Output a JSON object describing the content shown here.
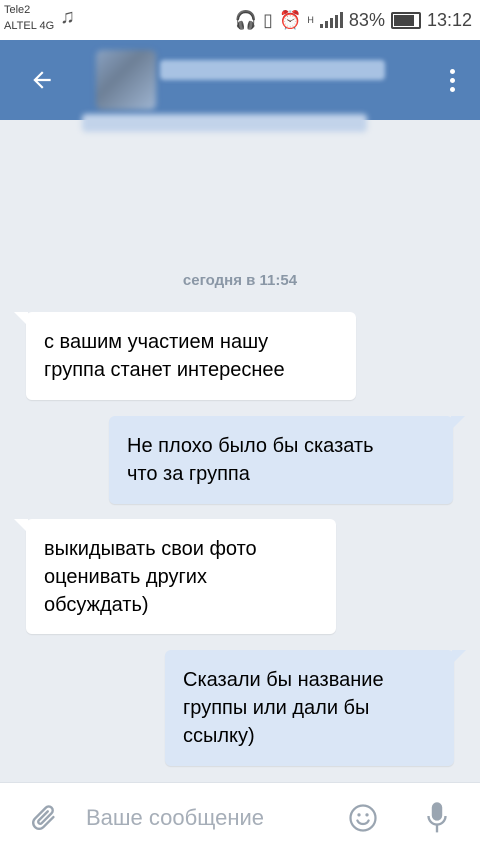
{
  "status_bar": {
    "carrier1": "Tele2",
    "carrier2": "ALTEL 4G",
    "network": "H",
    "battery": "83%",
    "time": "13:12"
  },
  "header": {
    "back_icon": "arrow-left-icon",
    "menu_icon": "more-vertical-icon"
  },
  "chat": {
    "date_separator": "сегодня в 11:54",
    "messages": [
      {
        "direction": "in",
        "lines": [
          "с вашим участием нашу",
          "группа станет интереснее"
        ]
      },
      {
        "direction": "out",
        "lines": [
          "Не плохо было бы сказать",
          "что за группа"
        ]
      },
      {
        "direction": "in",
        "lines": [
          "выкидывать свои фото",
          "оценивать других",
          "обсуждать)"
        ]
      },
      {
        "direction": "out",
        "lines": [
          "Сказали бы название",
          "группы или дали бы",
          "ссылку)"
        ]
      }
    ]
  },
  "composer": {
    "placeholder": "Ваше сообщение",
    "attach_icon": "paperclip-icon",
    "emoji_icon": "smile-icon",
    "mic_icon": "microphone-icon"
  },
  "colors": {
    "header_bg": "#5481b8",
    "chat_bg": "#e9edf2",
    "outgoing_bubble": "#dae6f6",
    "incoming_bubble": "#ffffff"
  }
}
